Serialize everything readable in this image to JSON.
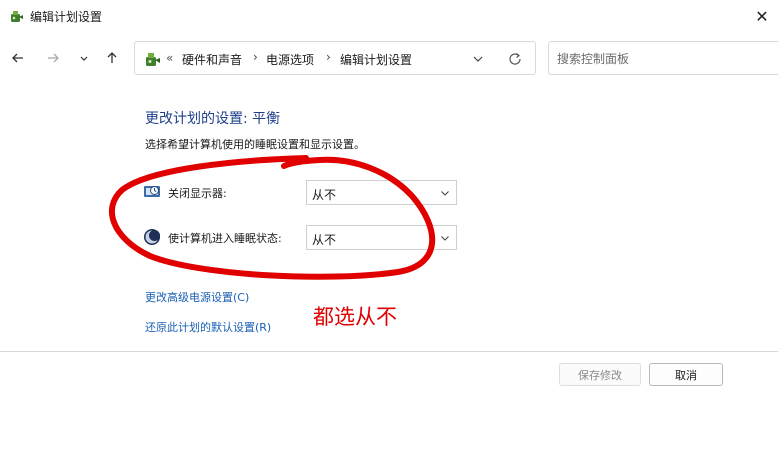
{
  "window": {
    "title": "编辑计划设置",
    "close_glyph": "✕"
  },
  "toolbar": {
    "icons": [
      "back-arrow-icon",
      "forward-arrow-icon",
      "recent-chevron-icon",
      "up-arrow-icon"
    ]
  },
  "address": {
    "overflow": "«",
    "breadcrumbs": [
      "硬件和声音",
      "电源选项",
      "编辑计划设置"
    ],
    "separator": "›"
  },
  "search": {
    "placeholder": "搜索控制面板",
    "value": ""
  },
  "main": {
    "title": "更改计划的设置: 平衡",
    "description": "选择希望计算机使用的睡眠设置和显示设置。",
    "settings": [
      {
        "label": "关闭显示器:",
        "value": "从不",
        "icon": "display-timer-icon"
      },
      {
        "label": "使计算机进入睡眠状态:",
        "value": "从不",
        "icon": "sleep-moon-icon"
      }
    ],
    "links": {
      "advanced": "更改高级电源设置(C)",
      "restore": "还原此计划的默认设置(R)"
    }
  },
  "annotation": {
    "text": "都选从不",
    "color": "#e00000"
  },
  "footer": {
    "save_label": "保存修改",
    "cancel_label": "取消"
  },
  "colors": {
    "title_blue": "#1e3f8a",
    "link_blue": "#1a5fb4"
  }
}
